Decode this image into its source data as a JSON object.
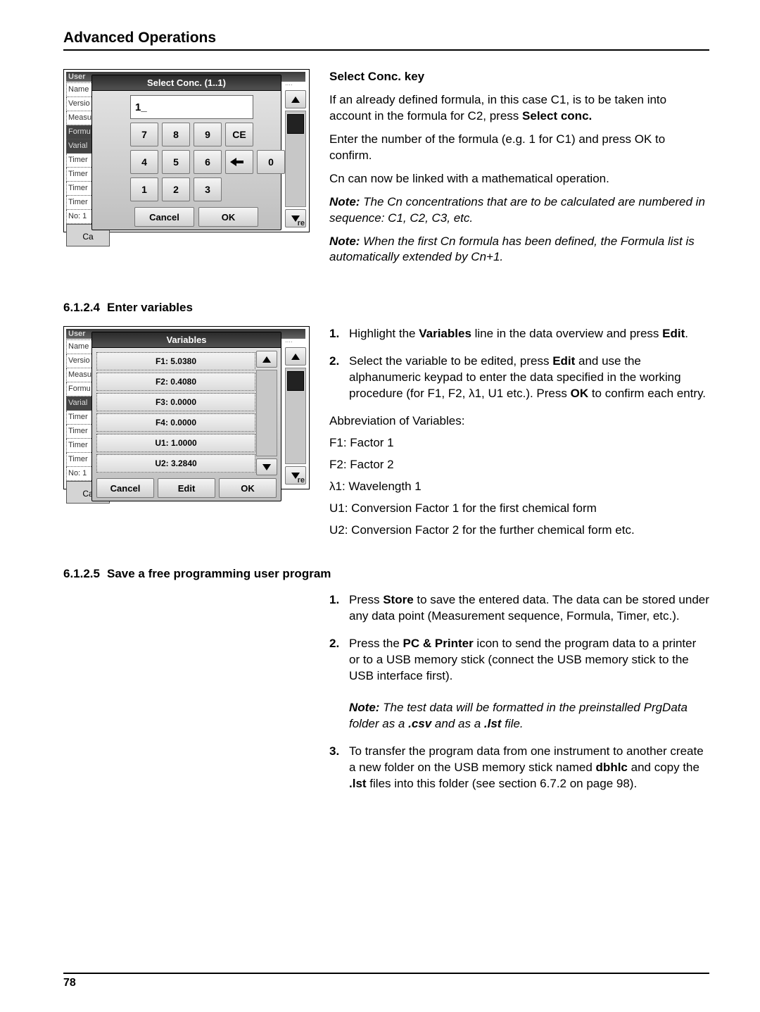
{
  "header": {
    "title": "Advanced Operations"
  },
  "footer": {
    "page_no": "78"
  },
  "dialog1": {
    "user_bar": "User",
    "modal_title": "Select Conc. (1..1)",
    "input_value": "1_",
    "keys": {
      "k7": "7",
      "k8": "8",
      "k9": "9",
      "ce": "CE",
      "k4": "4",
      "k5": "5",
      "k6": "6",
      "k0": "0",
      "k1": "1",
      "k2": "2",
      "k3": "3"
    },
    "cancel": "Cancel",
    "ok": "OK",
    "side_items": [
      "Name",
      "Versio",
      "Measu",
      "Formu",
      "Varial",
      "Timer",
      "Timer",
      "Timer",
      "Timer",
      "No: 1"
    ],
    "side_dark_indices": [
      3,
      4
    ],
    "ca": "Ca",
    "re": "re"
  },
  "dialog2": {
    "user_bar": "User",
    "modal_title": "Variables",
    "rows": [
      "F1: 5.0380",
      "F2: 0.4080",
      "F3: 0.0000",
      "F4: 0.0000",
      "U1: 1.0000",
      "U2: 3.2840"
    ],
    "cancel": "Cancel",
    "edit": "Edit",
    "ok": "OK",
    "side_items": [
      "Name",
      "Versio",
      "Measu",
      "Formu",
      "Varial",
      "Timer",
      "Timer",
      "Timer",
      "Timer",
      "No: 1"
    ],
    "side_dark_indices": [
      4
    ],
    "ca": "Ca",
    "re": "re"
  },
  "right1": {
    "h": "Select Conc. key",
    "p1a": "If an already defined formula, in this case C1, is to be taken into account in the formula for C2, press ",
    "p1b": "Select conc.",
    "p2": "Enter the number of the formula (e.g. 1 for C1) and press OK to confirm.",
    "p3": "Cn can now be linked with a mathematical operation.",
    "n1_label": "Note:",
    "n1_body": " The Cn concentrations that are to be calculated are numbered in sequence: C1, C2, C3, etc.",
    "n2_label": "Note:",
    "n2_body": " When the first Cn formula has been defined, the Formula list is automatically extended by Cn+1."
  },
  "sec_6124": {
    "num": "6.1.2.4",
    "title": "Enter variables"
  },
  "right2": {
    "s1_a": "Highlight the ",
    "s1_b": "Variables",
    "s1_c": " line in the data overview and press ",
    "s1_d": "Edit",
    "s1_e": ".",
    "s2_a": "Select the variable to be edited, press ",
    "s2_b": "Edit",
    "s2_c": " and use the alphanumeric keypad to enter the data specified in the working procedure (for F1, F2, λ1, U1 etc.). Press ",
    "s2_d": "OK",
    "s2_e": " to confirm each entry.",
    "abbr_h": "Abbreviation of Variables:",
    "a1": "F1: Factor 1",
    "a2": "F2: Factor 2",
    "a3": "λ1: Wavelength 1",
    "a4": "U1: Conversion Factor 1 for the first chemical form",
    "a5": "U2: Conversion Factor 2 for the further chemical form etc."
  },
  "sec_6125": {
    "num": "6.1.2.5",
    "title": "Save a free programming user program"
  },
  "right3": {
    "s1_a": "Press ",
    "s1_b": "Store",
    "s1_c": " to save the entered data. The data can be stored under any data point (Measurement sequence, Formula, Timer, etc.).",
    "s2_a": "Press the ",
    "s2_b": "PC & Printer",
    "s2_c": " icon to send the program data to a printer or to a USB memory stick (connect the USB memory stick to the USB interface first).",
    "n_label": "Note:",
    "n_a": " The test data will be formatted in the preinstalled PrgData folder as a ",
    "n_b": ".csv",
    "n_c": " and as a ",
    "n_d": ".lst",
    "n_e": " file.",
    "s3_a": "To transfer the program data from one instrument to another create a new folder on the USB memory stick named ",
    "s3_b": "dbhlc",
    "s3_c": " and copy the ",
    "s3_d": ".lst",
    "s3_e": " files into this folder (see ",
    "s3_f": "section 6.7.2 on page 98",
    "s3_g": ")."
  }
}
